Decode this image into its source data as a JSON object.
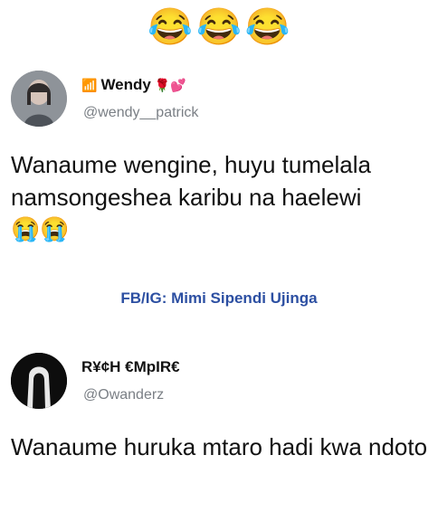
{
  "top_emojis": [
    "😂",
    "😂",
    "😂"
  ],
  "tweets": [
    {
      "name_prefix": "📶",
      "name": "Wendy",
      "name_suffix": "🌹💕",
      "handle": "@wendy__patrick",
      "text": "Wanaume wengine, huyu tumelala namsongeshea karibu na haelewi",
      "emojis": "😭😭"
    },
    {
      "name": "R¥¢H €MpIR€",
      "handle": "@Owanderz",
      "text": "Wanaume huruka mtaro hadi kwa ndoto"
    }
  ],
  "watermark": "FB/IG: Mimi Sipendi Ujinga"
}
